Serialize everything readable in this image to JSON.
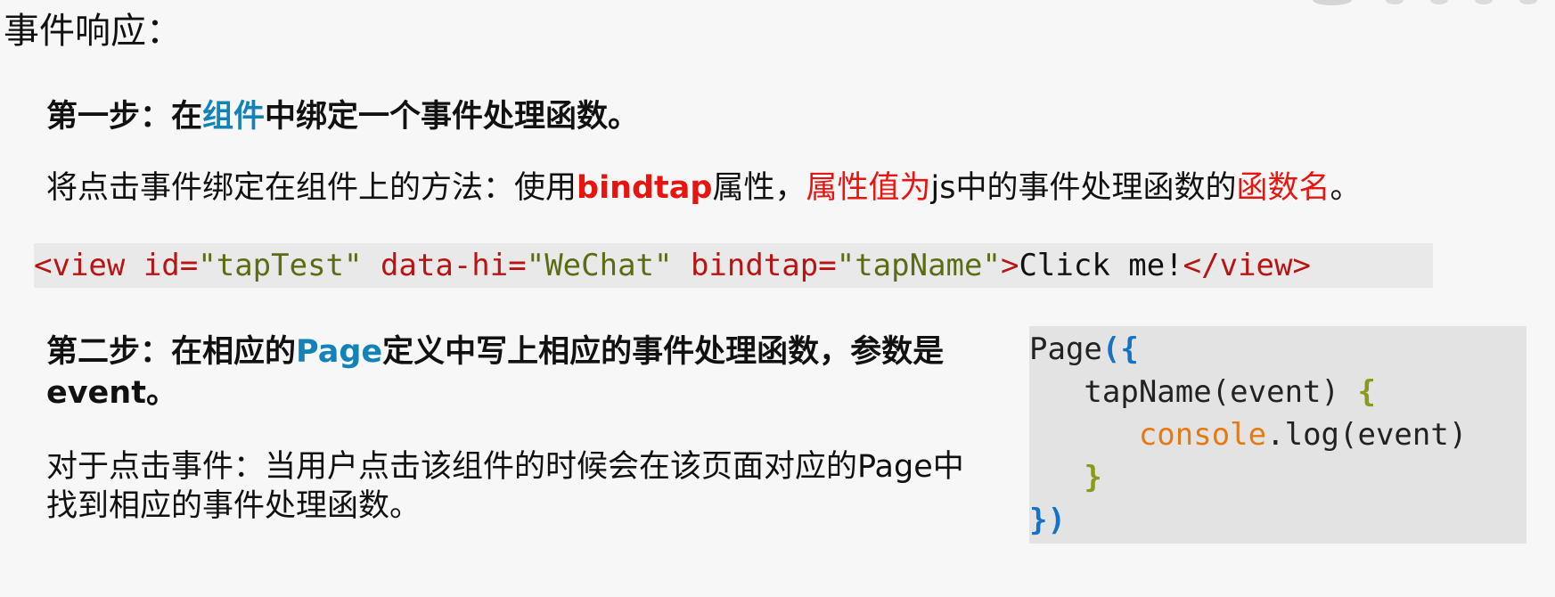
{
  "title": "事件响应：",
  "step1": {
    "prefix": "第一步：在",
    "highlight": "组件",
    "suffix": "中绑定一个事件处理函数。"
  },
  "desc1": {
    "part1": "将点击事件绑定在组件上的方法：使用",
    "bindtap": "bindtap",
    "part2": "属性，",
    "attr_value": "属性值为",
    "part3": "js中的事件处理函数的",
    "fn_name": "函数名",
    "part4": "。"
  },
  "code_line": {
    "open_tag": "<view",
    "attr1": " id=",
    "val1": "\"tapTest\"",
    "attr2": " data-hi=",
    "val2": "\"WeChat\"",
    "attr3": " bindtap=",
    "val3": "\"tapName\"",
    "gt": ">",
    "text": "Click me!",
    "close_tag": "</view>"
  },
  "step2": {
    "prefix": "第二步：在相应的",
    "highlight": "Page",
    "suffix": "定义中写上相应的事件处理函数，参数是event。"
  },
  "desc2": {
    "text": "对于点击事件：当用户点击该组件的时候会在该页面对应的Page中找到相应的事件处理函数。"
  },
  "code_box": {
    "l1_a": "Page",
    "l1_b": "({",
    "l2_indent": "   ",
    "l2_a": "tapName(event) ",
    "l2_b": "{",
    "l3_indent": "      ",
    "l3_a": "console",
    "l3_b": ".log(event)",
    "l4_indent": "   ",
    "l4_a": "}",
    "l5_a": "})"
  },
  "colors": {
    "accent_blue": "#1183b9",
    "accent_red": "#e8140f",
    "code_tag": "#b81414",
    "code_string": "#5a6d14",
    "js_brace_blue": "#1572c4",
    "js_brace_green": "#8a9a1c",
    "js_console": "#e57a12"
  }
}
